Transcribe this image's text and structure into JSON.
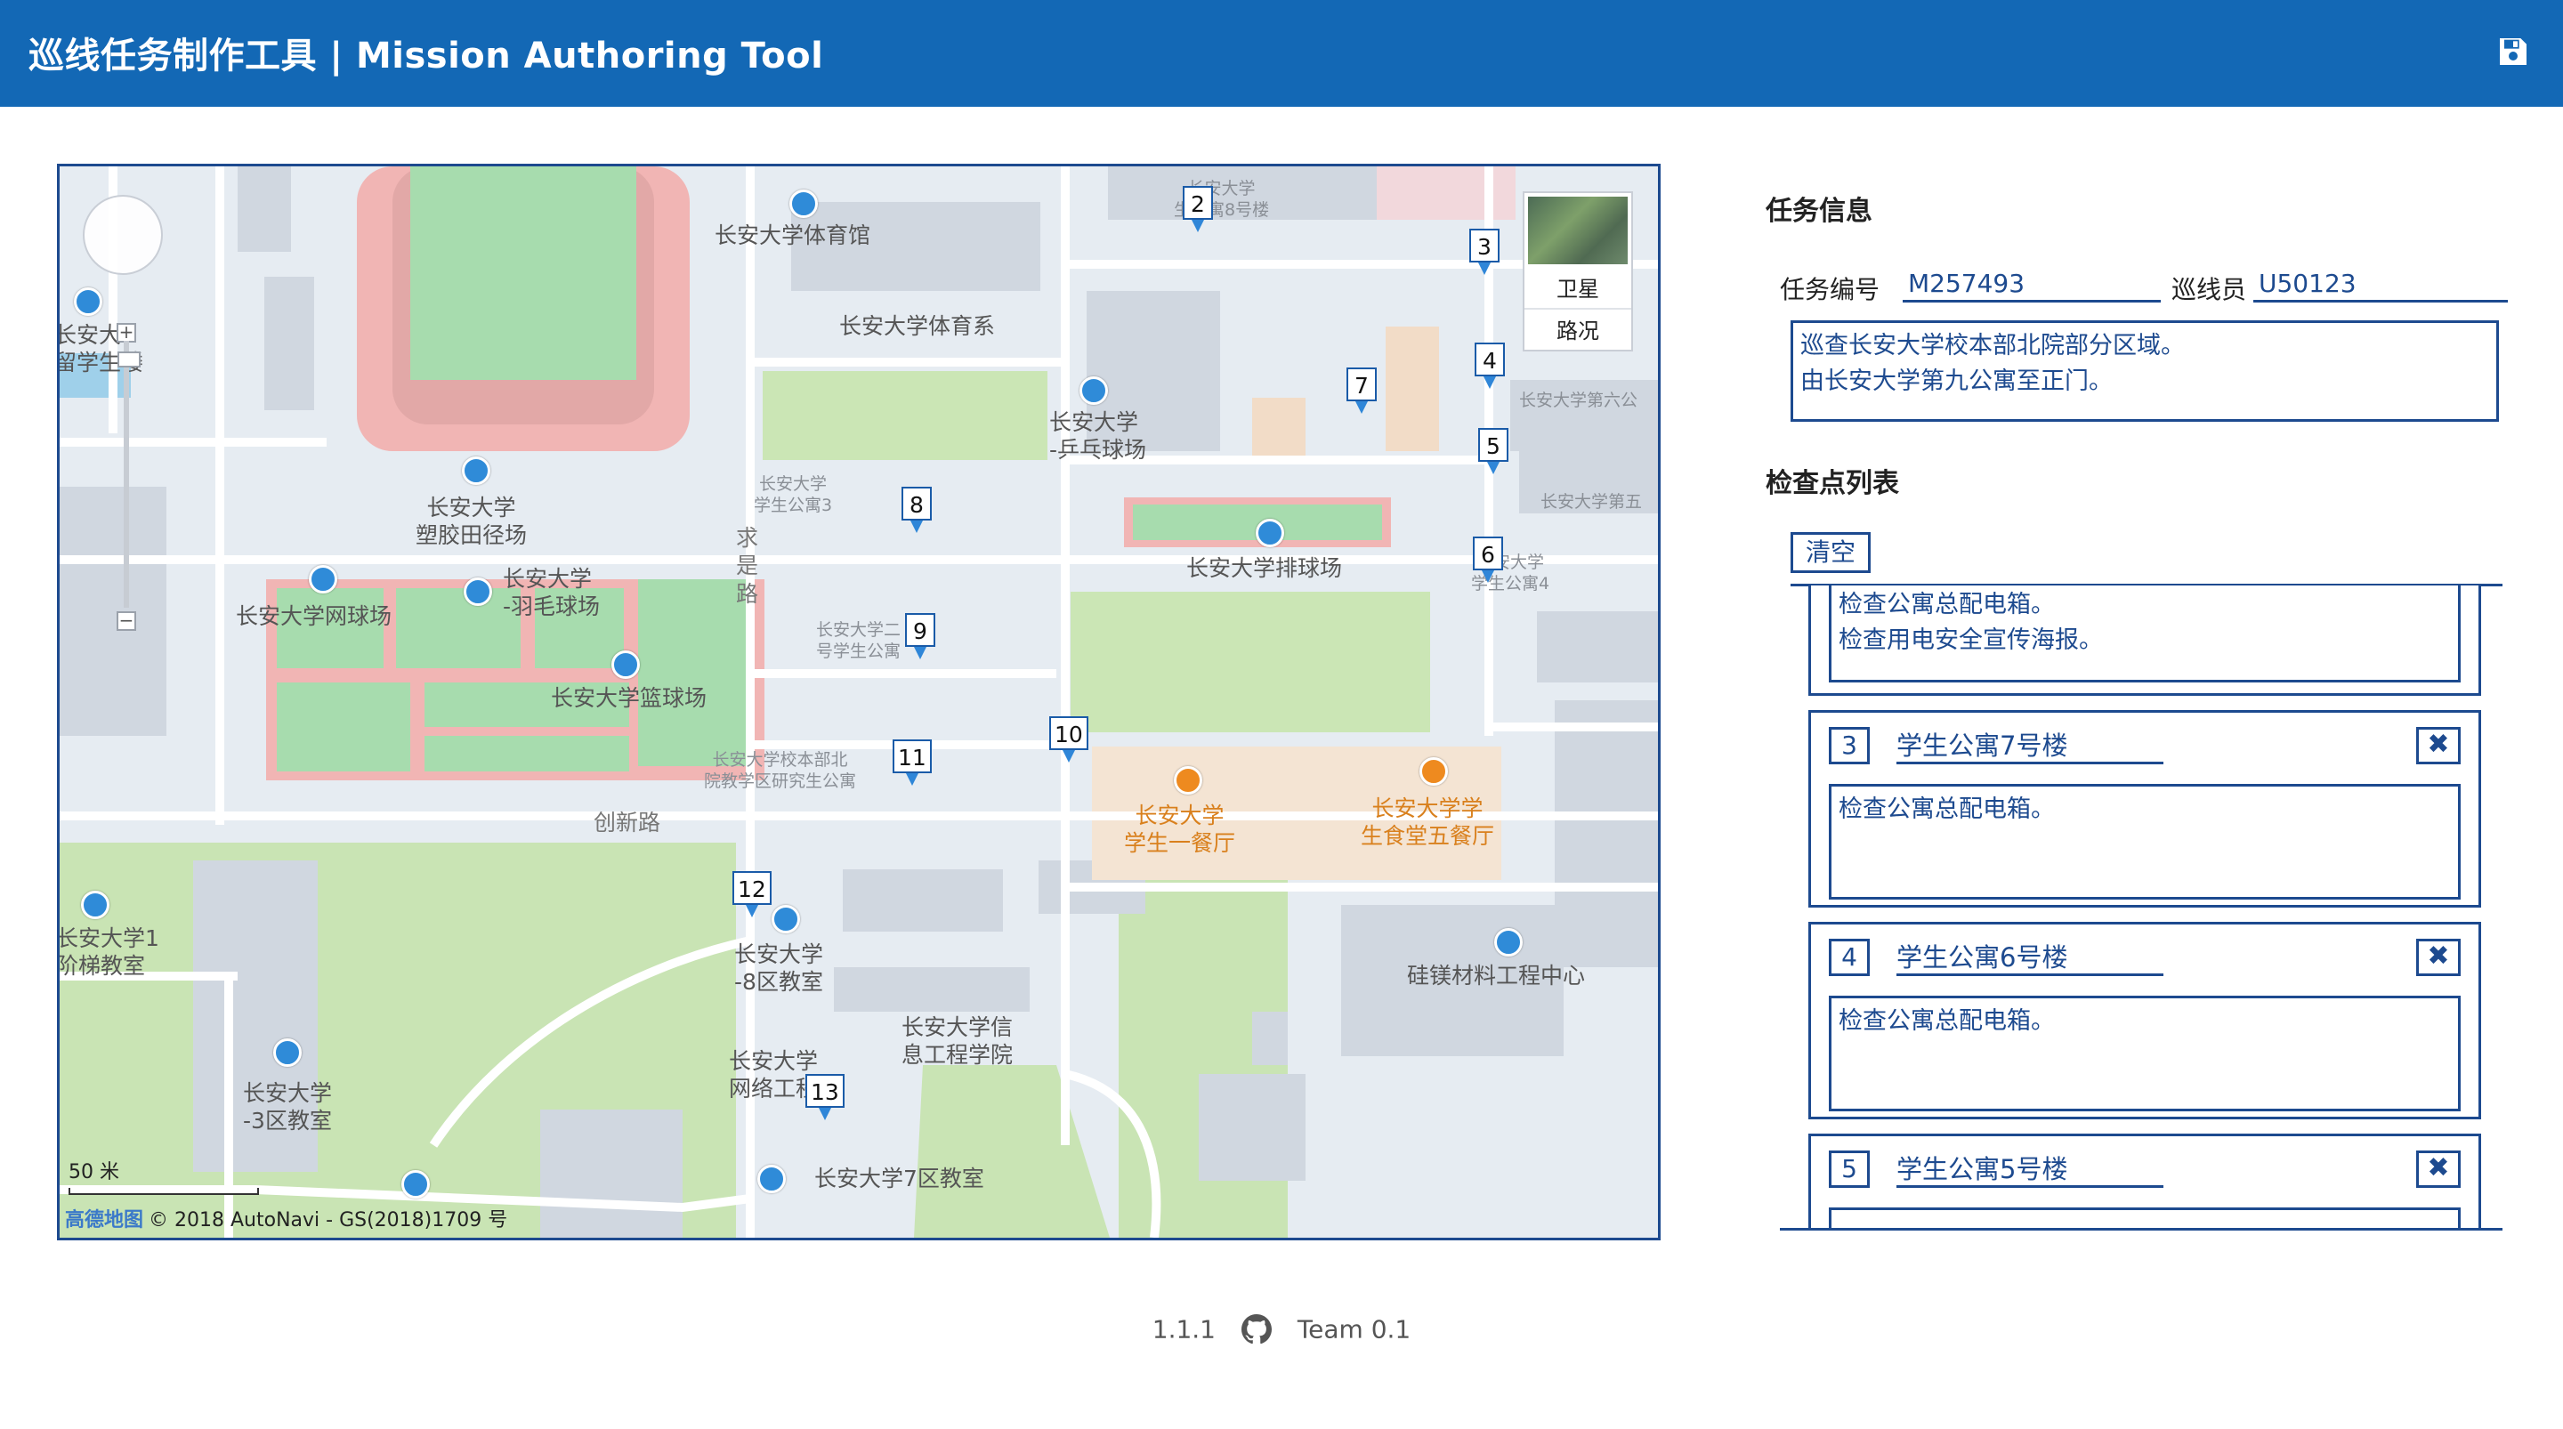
{
  "header": {
    "title": "巡线任务制作工具 | Mission Authoring Tool"
  },
  "map": {
    "layers": {
      "satellite": "卫星",
      "traffic": "路况"
    },
    "scale_label": "50 米",
    "attribution_brand": "高德地图",
    "attribution": "© 2018 AutoNavi - GS(2018)1709 号",
    "labels": {
      "gym": "长安大学体育馆",
      "pe_dept": "长安大学体育系",
      "track": "长安大学\n塑胶田径场",
      "tennis": "长安大学网球场",
      "badminton": "长安大学\n-羽毛球场",
      "basketball": "长安大学篮球场",
      "pingpong": "长安大学\n-乒乓球场",
      "volleyball": "长安大学排球场",
      "road_qiushi": "求\n是\n路",
      "road_chuangxin": "创新路",
      "canteen1": "长安大学\n学生一餐厅",
      "canteen5": "长安大学学\n生食堂五餐厅",
      "silicon": "硅镁材料工程中心",
      "classroom8": "长安大学\n-8区教室",
      "infoschool": "长安大学信\n息工程学院",
      "network": "长安大学\n网络工程",
      "classroom7": "长安大学7区教室",
      "classroom3": "长安大学\n-3区教室",
      "stairs1": "长安大学1\n阶梯教室",
      "intl": "长安大\n留学生楼",
      "dorm3": "长安大学\n学生公寓3",
      "dorm_small": "长安大学二\n号学生公寓",
      "research": "长安大学校本部北\n院教学区研究生公寓",
      "dorm8": "长安大学\n生公寓8号楼",
      "dorm6_r": "长安大学第六公",
      "dorm5_r": "长安大学第五",
      "dorm4_r": "长安大学\n学生公寓4"
    },
    "markers": [
      "2",
      "3",
      "4",
      "5",
      "6",
      "7",
      "8",
      "9",
      "10",
      "11",
      "12",
      "13"
    ]
  },
  "panel": {
    "mission_title": "任务信息",
    "mission_id_label": "任务编号",
    "mission_id": "M257493",
    "inspector_label": "巡线员",
    "inspector_id": "U50123",
    "description": "巡查长安大学校本部北院部分区域。\n由长安大学第九公寓至正门。",
    "checkpoints_title": "检查点列表",
    "clear_label": "清空",
    "partial_note": "检查公寓总配电箱。\n检查用电安全宣传海报。",
    "checkpoints": [
      {
        "num": "3",
        "name": "学生公寓7号楼",
        "note": "检查公寓总配电箱。",
        "delete_icon": "✖"
      },
      {
        "num": "4",
        "name": "学生公寓6号楼",
        "note": "检查公寓总配电箱。",
        "delete_icon": "✖"
      },
      {
        "num": "5",
        "name": "学生公寓5号楼",
        "note": "",
        "delete_icon": "✖"
      }
    ]
  },
  "footer": {
    "version": "1.1.1",
    "team": "Team 0.1"
  },
  "colors": {
    "header": "#1368b5",
    "accent": "#1d4a8f",
    "marker_pin": "#2f86d8"
  }
}
